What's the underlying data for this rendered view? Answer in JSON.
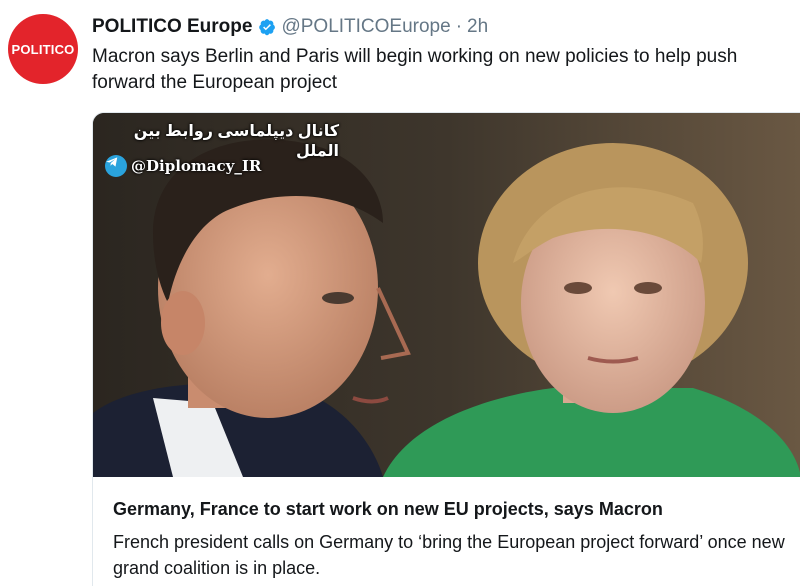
{
  "account": {
    "avatar_text": "POLITICO",
    "display_name": "POLITICO Europe",
    "handle": "@POLITICOEurope",
    "separator": "·",
    "timestamp": "2h",
    "avatar_color": "#e3242b",
    "verified_icon": "verified-badge-icon"
  },
  "tweet": {
    "text": "Macron says Berlin and Paris will begin working on new policies to help push forward the European project"
  },
  "card": {
    "watermark": {
      "channel_text": "کانال دیپلماسی روابط بین الملل",
      "handle": "@Diplomacy_IR",
      "icon": "telegram-icon"
    },
    "title": "Germany, France to start work on new EU projects, says Macron",
    "description": "French president calls on Germany to ‘bring the European project forward’ once new grand coalition is in place."
  },
  "colors": {
    "text": "#14171a",
    "secondary_text": "#657786",
    "verified": "#1da1f2",
    "telegram": "#2aa3dd"
  }
}
